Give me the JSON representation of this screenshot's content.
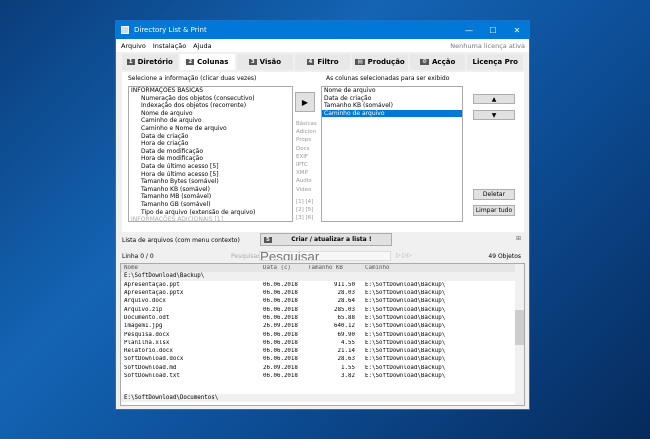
{
  "window": {
    "title": "Directory List & Print",
    "minimize": "—",
    "maximize": "☐",
    "close": "✕"
  },
  "menu": {
    "items": [
      "Arquivo",
      "Instalação",
      "Ajuda"
    ],
    "license": "Nenhuma licença ativa"
  },
  "tabs": [
    {
      "num": "1",
      "label": "Diretório"
    },
    {
      "num": "2",
      "label": "Colunas"
    },
    {
      "num": "3",
      "label": "Visão"
    },
    {
      "num": "4",
      "label": "Filtro"
    },
    {
      "num": "▤",
      "label": "Produção"
    },
    {
      "num": "⚙",
      "label": "Acção"
    },
    {
      "num": "",
      "label": "Licença Pro"
    }
  ],
  "left": {
    "label": "Selecione a informação (clicar duas vezes)",
    "items": [
      "INFORMAÇÕES BÁSICAS",
      "Numeração dos objetos  (consecutivo)",
      "Indexação dos objetos  (recorrente)",
      "Nome de arquivo",
      "Caminho de arquivo",
      "Caminho e Nome de arquivo",
      "Data de criação",
      "Hora de criação",
      "Data de modificação",
      "Hora de modificação",
      "Data de último acesso [5]",
      "Hora de último acesso [5]",
      "Tamanho Bytes  (somável)",
      "Tamanho KB  (somável)",
      "Tamanho MB  (somável)",
      "Tamanho GB  (somável)",
      "Tipo de arquivo  (extensão de arquivo)",
      "INFORMAÇÕES ADICIONAIS [1]"
    ]
  },
  "middle": {
    "add": "▶",
    "categories": [
      "Básicas",
      "Adicion",
      "Props",
      "Docs",
      "EXIF",
      "IPTC",
      "XMP",
      "Audio",
      "Video"
    ],
    "pages": [
      "[1]  [4]",
      "[2]  [5]",
      "[3]  [6]"
    ]
  },
  "right": {
    "label": "As colunas selecionadas para ser exibido",
    "items": [
      "Nome de arquivo",
      "Data de criação",
      "Tamanho KB  (somável)",
      "Caminho de arquivo"
    ],
    "up": "▲",
    "down": "▼",
    "delete": "Deletar",
    "clear": "Limpar tudo"
  },
  "bottom": {
    "list_label": "Lista de arquivos (com menu contexto)",
    "create_num": "5",
    "create": "Criar / atualizar a lista !",
    "line": "Linha 0 / 0",
    "search_placeholder": "Pesquisar",
    "objects": "49 Objetos"
  },
  "table": {
    "headers": [
      "Nome",
      "Data (c)",
      "Tamanho KB",
      "Caminho"
    ],
    "group1": "E:\\SoftDownload\\Backup\\",
    "rows": [
      [
        "Apresentação.ppt",
        "06.06.2018",
        "911.50",
        "E:\\SoftDownload\\Backup\\"
      ],
      [
        "Apresentação.pptx",
        "06.06.2018",
        "28.03",
        "E:\\SoftDownload\\Backup\\"
      ],
      [
        "Arquivo.docx",
        "06.06.2018",
        "28.64",
        "E:\\SoftDownload\\Backup\\"
      ],
      [
        "Arquivo.zip",
        "06.06.2018",
        "285.03",
        "E:\\SoftDownload\\Backup\\"
      ],
      [
        "Documento.odt",
        "06.06.2018",
        "65.88",
        "E:\\SoftDownload\\Backup\\"
      ],
      [
        "imagem1.jpg",
        "26.09.2018",
        "640.12",
        "E:\\SoftDownload\\Backup\\"
      ],
      [
        "Pesquisa.docx",
        "06.06.2018",
        "69.90",
        "E:\\SoftDownload\\Backup\\"
      ],
      [
        "Planilha.xlsx",
        "06.06.2018",
        "4.55",
        "E:\\SoftDownload\\Backup\\"
      ],
      [
        "Relatório.docx",
        "06.06.2018",
        "21.14",
        "E:\\SoftDownload\\Backup\\"
      ],
      [
        "SoftDownload.docx",
        "06.06.2018",
        "28.63",
        "E:\\SoftDownload\\Backup\\"
      ],
      [
        "SoftDownload.md",
        "26.09.2018",
        "1.55",
        "E:\\SoftDownload\\Backup\\"
      ],
      [
        "SoftDownload.txt",
        "06.06.2018",
        "3.82",
        "E:\\SoftDownload\\Backup\\"
      ]
    ],
    "group2": "E:\\SoftDownload\\Documentos\\"
  }
}
